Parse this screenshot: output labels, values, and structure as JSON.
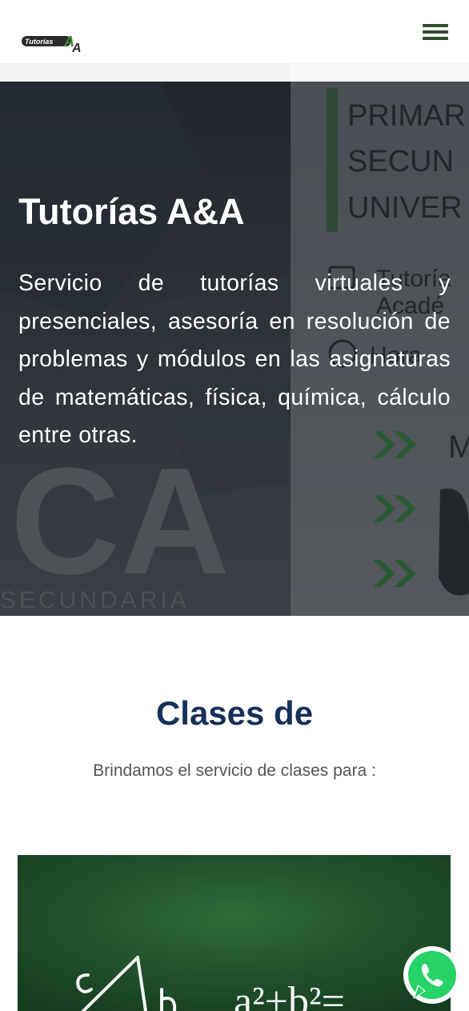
{
  "header": {
    "logo_text": "TutoríasAA",
    "menu_icon": "hamburger-menu-icon"
  },
  "hero": {
    "title": "Tutorías A&A",
    "text": "Servicio de tutorías virtuales y presenciales, asesoría en resolución de problemas y módulos en las asignaturas de matemáticas, física, química, cálculo entre otras.",
    "bg_poster_lines": [
      "PRIMAR",
      "SECUN",
      "UNIVER"
    ],
    "bg_poster_items": [
      "Tutoría",
      "Acadé",
      "Hora"
    ],
    "bg_big_text": "ICA",
    "bg_small_text": "SECUNDARIA"
  },
  "classes": {
    "title": "Clases de",
    "subtitle": "Brindamos el servicio de clases para :",
    "image_formula": "a²+b²="
  },
  "whatsapp": {
    "icon": "whatsapp-icon",
    "color": "#25d366"
  },
  "colors": {
    "brand_green": "#2e4f2a",
    "heading_blue": "#16305a",
    "chalkboard": "#21552d"
  }
}
